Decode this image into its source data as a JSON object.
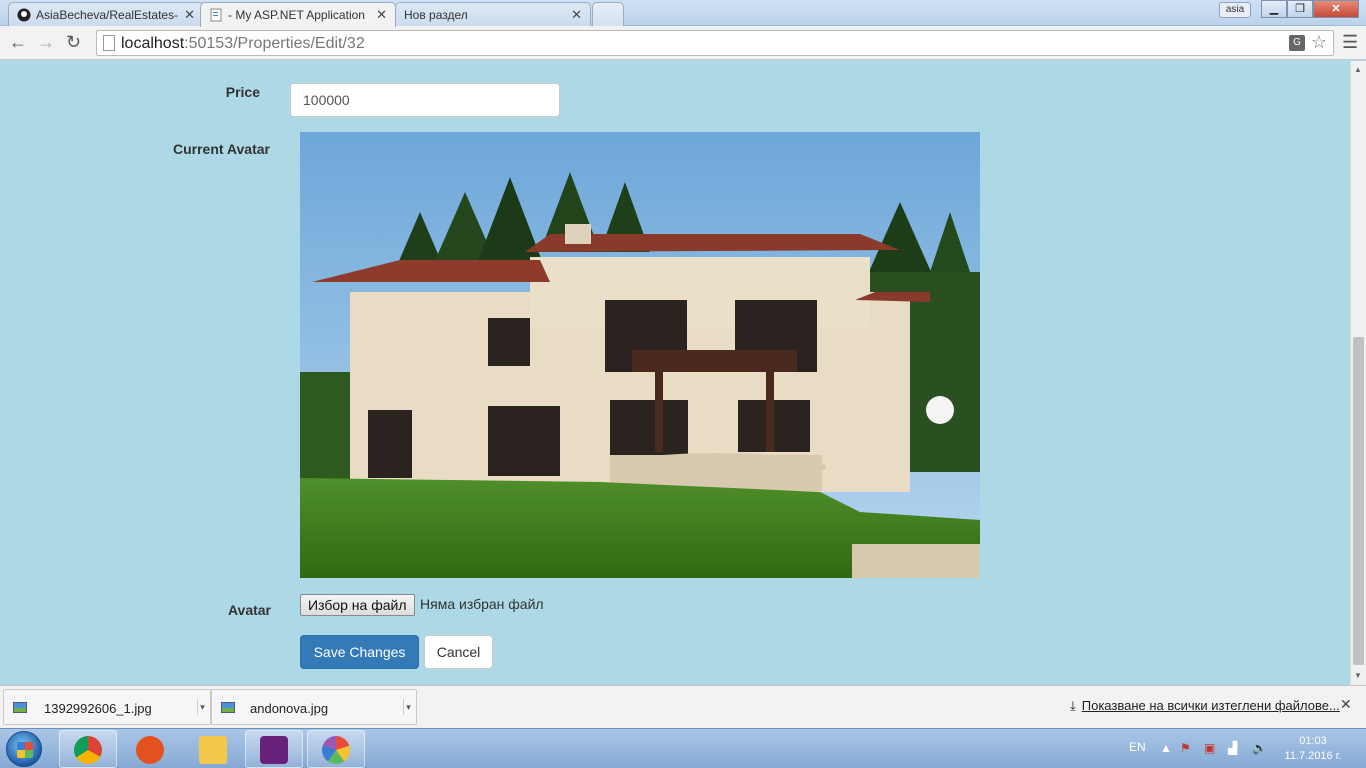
{
  "browser": {
    "tabs": [
      {
        "title": "AsiaBecheva/RealEstates-",
        "active": false
      },
      {
        "title": "- My ASP.NET Application",
        "active": true
      },
      {
        "title": "Нов раздел",
        "active": false
      }
    ],
    "profile_name": "asia",
    "url_host": "localhost",
    "url_rest": ":50153/Properties/Edit/32",
    "icons": [
      "back-icon",
      "forward-icon",
      "reload-icon",
      "page-icon",
      "translate-icon",
      "star-icon",
      "menu-icon"
    ]
  },
  "form": {
    "price_label": "Price",
    "price_value": "100000",
    "current_avatar_label": "Current Avatar",
    "avatar_label": "Avatar",
    "file_button": "Избор на файл",
    "file_status": "Няма избран файл",
    "save_button": "Save Changes",
    "cancel_button": "Cancel"
  },
  "downloads": {
    "items": [
      {
        "name": "1392992606_1.jpg"
      },
      {
        "name": "andonova.jpg"
      }
    ],
    "show_all": "Показване на всички изтеглени файлове..."
  },
  "taskbar": {
    "apps": [
      "chrome-icon",
      "filezilla-icon",
      "explorer-icon",
      "visual-studio-icon",
      "picasa-icon"
    ],
    "language": "EN",
    "time": "01:03",
    "date": "11.7.2016 г."
  },
  "colors": {
    "page_background": "#add8e6",
    "primary_button": "#337ab7"
  }
}
